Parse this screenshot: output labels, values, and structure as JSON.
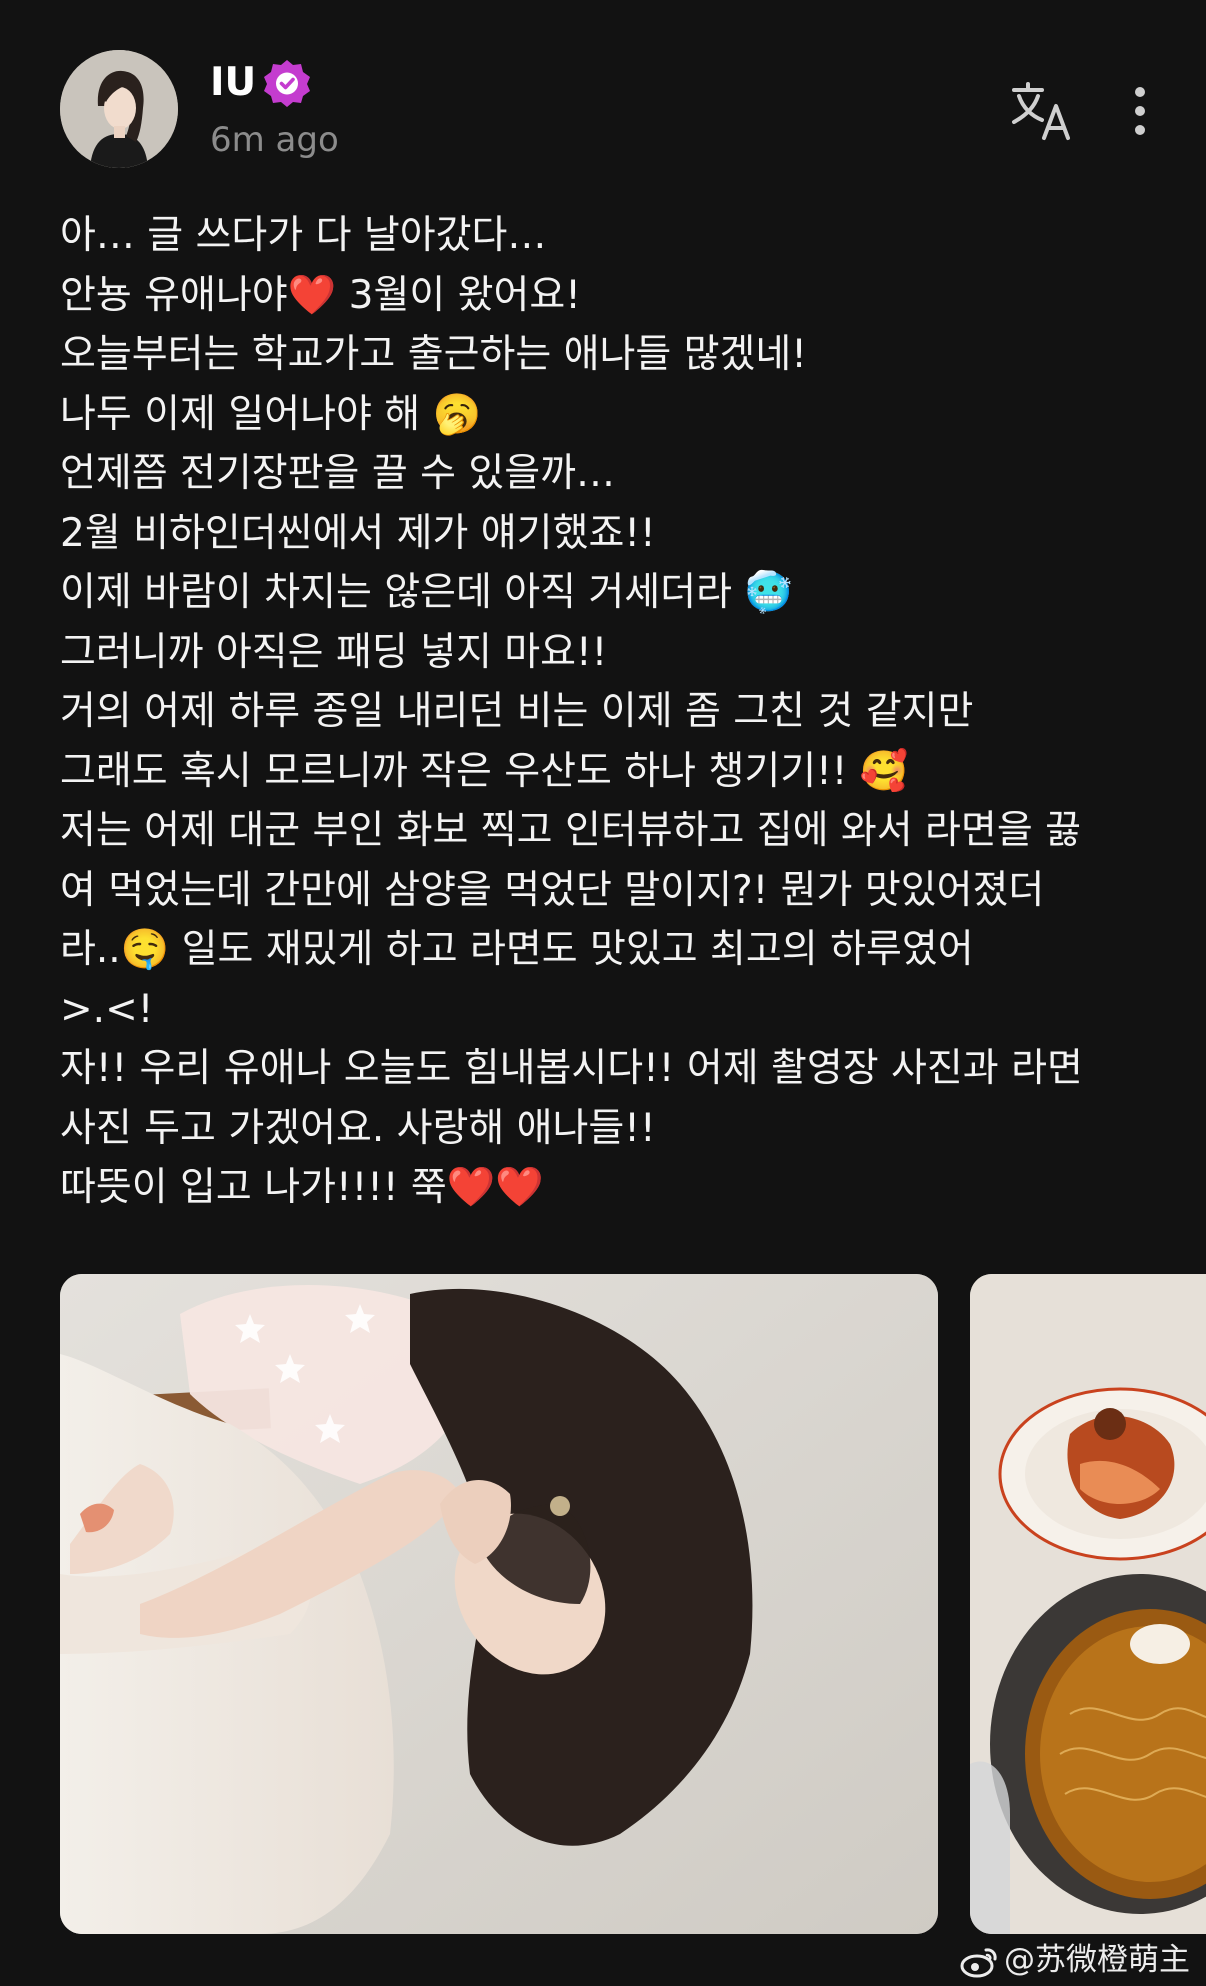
{
  "header": {
    "author_name": "IU",
    "timestamp": "6m ago",
    "verified_color": "#c43ccf",
    "icons": [
      "avatar",
      "verified-badge-icon",
      "translate-icon",
      "more-options-icon"
    ]
  },
  "post": {
    "lines": [
      "아… 글 쓰다가 다 날아갔다…",
      "안뇽 유애나야❤️ 3월이 왔어요!",
      "오늘부터는 학교가고 출근하는 애나들 많겠네!",
      "나두 이제 일어나야 해 🥱",
      "언제쯤 전기장판을 끌 수 있을까…",
      "2월 비하인더씬에서 제가 얘기했죠!!",
      "이제 바람이 차지는 않은데 아직 거세더라 🥶",
      "그러니까 아직은 패딩 넣지 마요!!",
      "거의 어제 하루 종일 내리던 비는 이제 좀 그친 것 같지만",
      "그래도 혹시 모르니까 작은 우산도 하나 챙기기!! 🥰",
      " 저는 어제 대군 부인 화보 찍고 인터뷰하고 집에 와서 라면을 끓",
      "여 먹었는데 간만에 삼양을 먹었단 말이지?! 뭔가 맛있어졌더",
      "라..🤤 일도 재밌게 하고 라면도 맛있고 최고의 하루였어",
      ">.<!",
      "자!! 우리 유애나 오늘도 힘내봅시다!! 어제 촬영장 사진과 라면",
      "사진 두고 가겠어요. 사랑해 애나들!!",
      "따뜻이 입고 나가!!!! 쭉❤️❤️"
    ]
  },
  "gallery": {
    "photos": [
      "photo-woman-in-white-dress",
      "photo-ramen-and-kimchi"
    ]
  },
  "watermark": {
    "text": "@苏微橙萌主"
  }
}
